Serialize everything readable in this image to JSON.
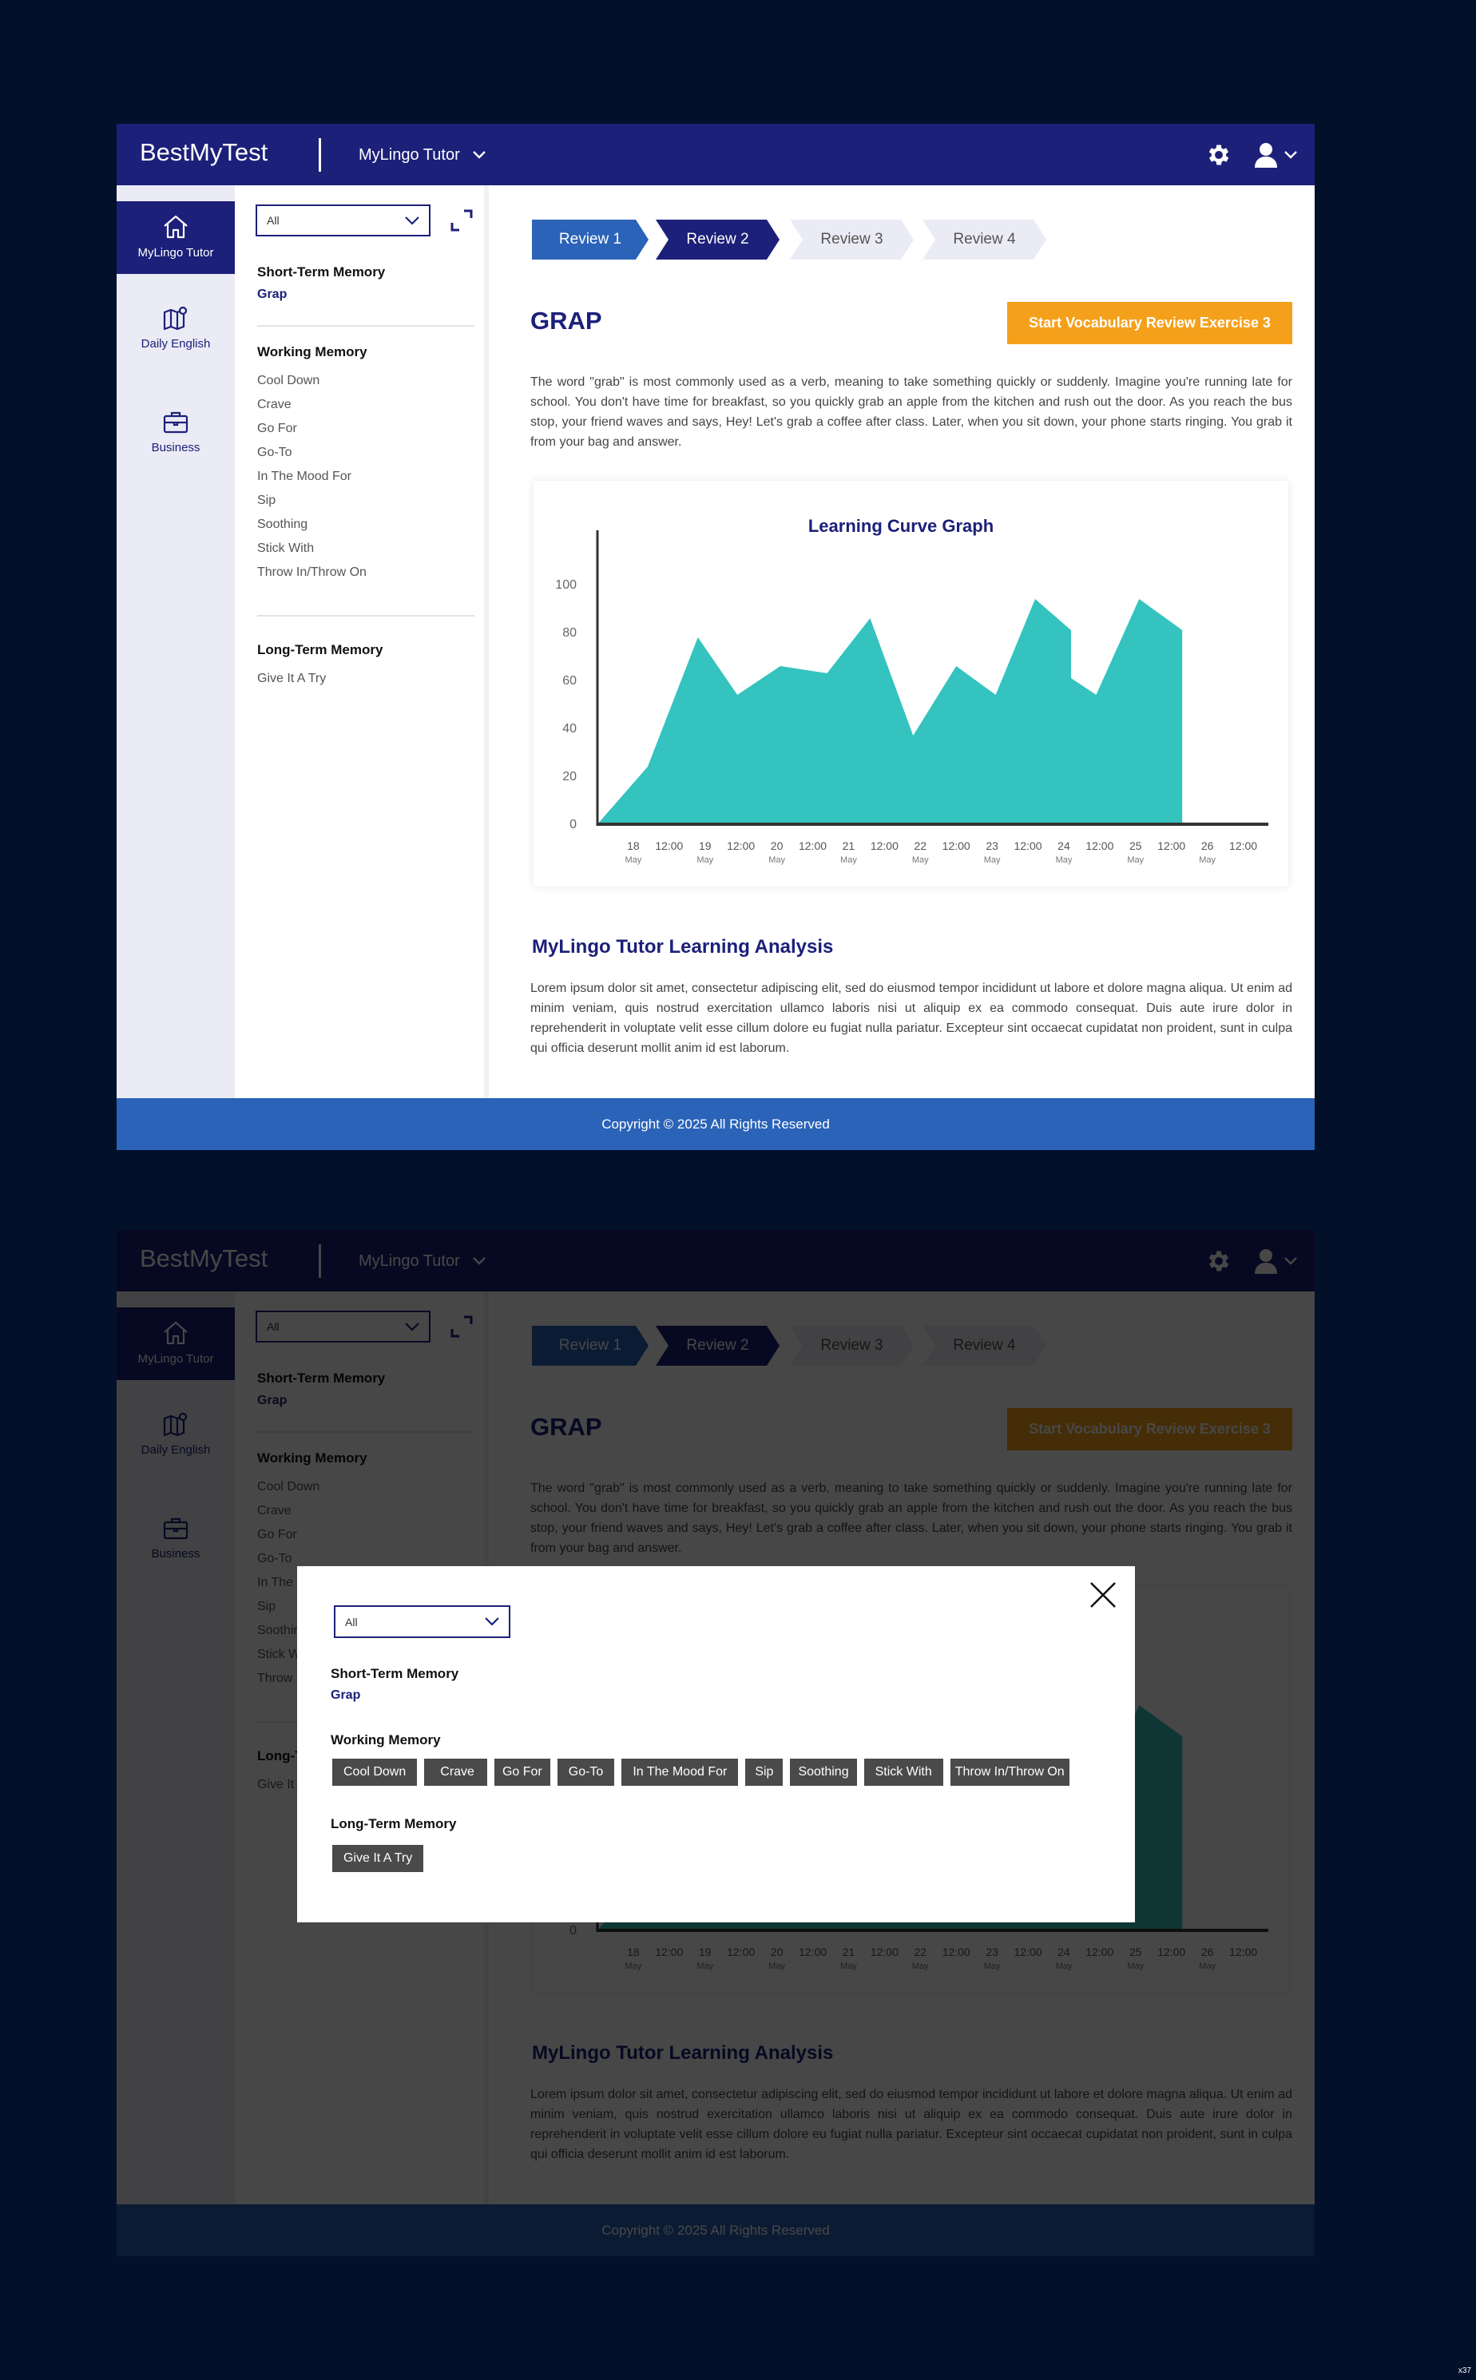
{
  "header": {
    "brand": "BestMyTest",
    "app_selector": "MyLingo Tutor"
  },
  "nav": [
    {
      "label": "MyLingo Tutor",
      "icon": "home-icon",
      "active": true
    },
    {
      "label": "Daily English",
      "icon": "map-icon",
      "active": false
    },
    {
      "label": "Business",
      "icon": "briefcase-icon",
      "active": false
    }
  ],
  "filter": {
    "value": "All"
  },
  "memory": {
    "short_term": {
      "title": "Short-Term Memory",
      "items": [
        "Grap"
      ]
    },
    "working": {
      "title": "Working Memory",
      "items": [
        "Cool Down",
        "Crave",
        "Go For",
        "Go-To",
        "In The Mood For",
        "Sip",
        "Soothing",
        "Stick With",
        "Throw In/Throw On"
      ]
    },
    "long_term": {
      "title": "Long-Term Memory",
      "items": [
        "Give It A Try"
      ]
    }
  },
  "steps": [
    "Review 1",
    "Review 2",
    "Review 3",
    "Review 4"
  ],
  "word": "GRAP",
  "start_button": "Start Vocabulary Review Exercise 3",
  "description": "The word \"grab\" is most commonly used as a verb, meaning to take something quickly or suddenly. Imagine you're running late for school. You don't have time for breakfast, so you quickly grab an apple from the kitchen and rush out the door. As you reach the bus stop, your friend waves and says, Hey! Let's grab a coffee after class. Later, when you sit down, your phone starts ringing. You grab it from your bag and answer.",
  "chart_data": {
    "type": "area",
    "title": "Learning Curve Graph",
    "xlabel": "",
    "ylabel": "",
    "ylim": [
      0,
      110
    ],
    "yticks": [
      0,
      20,
      40,
      60,
      80,
      100
    ],
    "xticks": [
      {
        "t": 0.5,
        "top": "18",
        "bottom": "May"
      },
      {
        "t": 1.0,
        "top": "12:00",
        "bottom": ""
      },
      {
        "t": 1.5,
        "top": "19",
        "bottom": "May"
      },
      {
        "t": 2.0,
        "top": "12:00",
        "bottom": ""
      },
      {
        "t": 2.5,
        "top": "20",
        "bottom": "May"
      },
      {
        "t": 3.0,
        "top": "12:00",
        "bottom": ""
      },
      {
        "t": 3.5,
        "top": "21",
        "bottom": "May"
      },
      {
        "t": 4.0,
        "top": "12:00",
        "bottom": ""
      },
      {
        "t": 4.5,
        "top": "22",
        "bottom": "May"
      },
      {
        "t": 5.0,
        "top": "12:00",
        "bottom": ""
      },
      {
        "t": 5.5,
        "top": "23",
        "bottom": "May"
      },
      {
        "t": 6.0,
        "top": "12:00",
        "bottom": ""
      },
      {
        "t": 6.5,
        "top": "24",
        "bottom": "May"
      },
      {
        "t": 7.0,
        "top": "12:00",
        "bottom": ""
      },
      {
        "t": 7.5,
        "top": "25",
        "bottom": "May"
      },
      {
        "t": 8.0,
        "top": "12:00",
        "bottom": ""
      },
      {
        "t": 8.5,
        "top": "26",
        "bottom": "May"
      },
      {
        "t": 9.0,
        "top": "12:00",
        "bottom": ""
      }
    ],
    "xlim": [
      0,
      9.35
    ],
    "points": [
      [
        0.0,
        0
      ],
      [
        0.7,
        24
      ],
      [
        1.4,
        78
      ],
      [
        1.95,
        54
      ],
      [
        2.55,
        66
      ],
      [
        3.2,
        63
      ],
      [
        3.8,
        86
      ],
      [
        4.4,
        37
      ],
      [
        5.0,
        66
      ],
      [
        5.55,
        54
      ],
      [
        6.1,
        94
      ],
      [
        6.6,
        81
      ],
      [
        6.6,
        61
      ],
      [
        6.95,
        54
      ],
      [
        7.55,
        94
      ],
      [
        8.15,
        81
      ],
      [
        8.15,
        0
      ]
    ],
    "fill_color": "#34c3bf"
  },
  "analysis": {
    "title": "MyLingo Tutor Learning Analysis",
    "text": "Lorem ipsum dolor sit amet, consectetur adipiscing elit, sed do eiusmod tempor incididunt ut labore et dolore magna aliqua. Ut enim ad minim veniam, quis nostrud exercitation ullamco laboris nisi ut aliquip ex ea commodo consequat. Duis aute irure dolor in reprehenderit in voluptate velit esse cillum dolore eu fugiat nulla pariatur. Excepteur sint occaecat cupidatat non proident, sunt in culpa qui officia deserunt mollit anim id est laborum."
  },
  "footer": "Copyright © 2025 All Rights Reserved",
  "badge": "x37",
  "colors": {
    "navy": "#1c2079",
    "blue": "#2a63b8",
    "orange": "#f5a01a",
    "teal": "#34c3bf"
  }
}
